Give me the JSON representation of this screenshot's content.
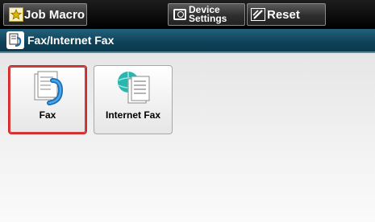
{
  "toolbar": {
    "job_macro_label": "Job Macro",
    "device_settings_line1": "Device",
    "device_settings_line2": "Settings",
    "reset_label": "Reset"
  },
  "header": {
    "title": "Fax/Internet Fax"
  },
  "tiles": [
    {
      "label": "Fax",
      "icon": "fax-document-phone-icon",
      "selected": true
    },
    {
      "label": "Internet Fax",
      "icon": "globe-document-icon",
      "selected": false
    }
  ],
  "colors": {
    "toolbar_bg": "#000000",
    "title_bg": "#0e4258",
    "selected_border": "#d23b3b"
  }
}
